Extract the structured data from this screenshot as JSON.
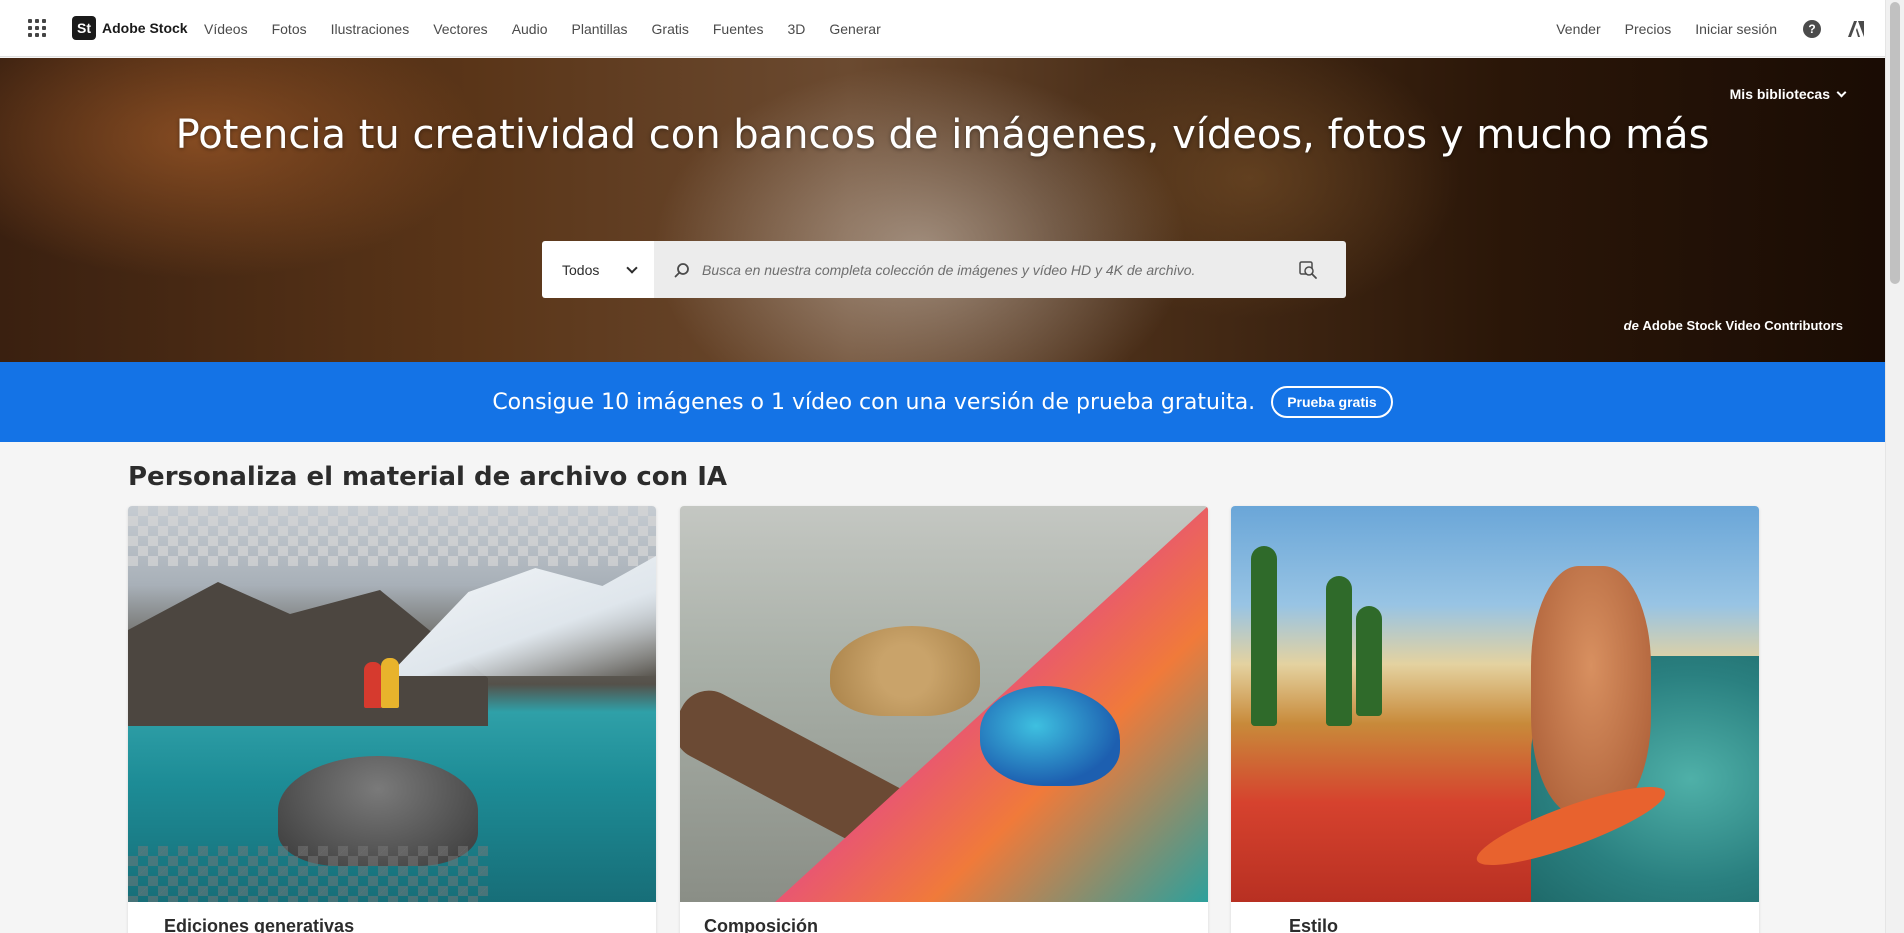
{
  "topnav": {
    "brand_logo": "St",
    "brand_name": "Adobe Stock",
    "links": [
      "Vídeos",
      "Fotos",
      "Ilustraciones",
      "Vectores",
      "Audio",
      "Plantillas",
      "Gratis",
      "Fuentes",
      "3D",
      "Generar"
    ],
    "right": {
      "sell": "Vender",
      "pricing": "Precios",
      "sign_in": "Iniciar sesión",
      "help": "?"
    }
  },
  "hero": {
    "title": "Potencia tu creatividad con bancos de imágenes, vídeos, fotos y mucho más",
    "libraries": "Mis bibliotecas",
    "search": {
      "category": "Todos",
      "placeholder": "Busca en nuestra completa colección de imágenes y vídeo HD y 4K de archivo."
    },
    "credit_prefix": "de",
    "credit_name": "Adobe Stock Video Contributors"
  },
  "promo": {
    "text": "Consigue 10 imágenes o 1 vídeo con una versión de prueba gratuita.",
    "button": "Prueba gratis"
  },
  "section": {
    "title": "Personaliza el material de archivo con IA",
    "cards": [
      {
        "label": "Ediciones generativas"
      },
      {
        "label": "Composición"
      },
      {
        "label": "Estilo"
      }
    ]
  },
  "colors": {
    "accent": "#1473e6",
    "nav_text": "#4b4b4b",
    "page_bg": "#f5f5f5"
  },
  "icons": [
    "apps-grid-icon",
    "search-icon",
    "visual-search-icon",
    "chevron-down-icon",
    "help-icon",
    "adobe-logo-icon"
  ]
}
